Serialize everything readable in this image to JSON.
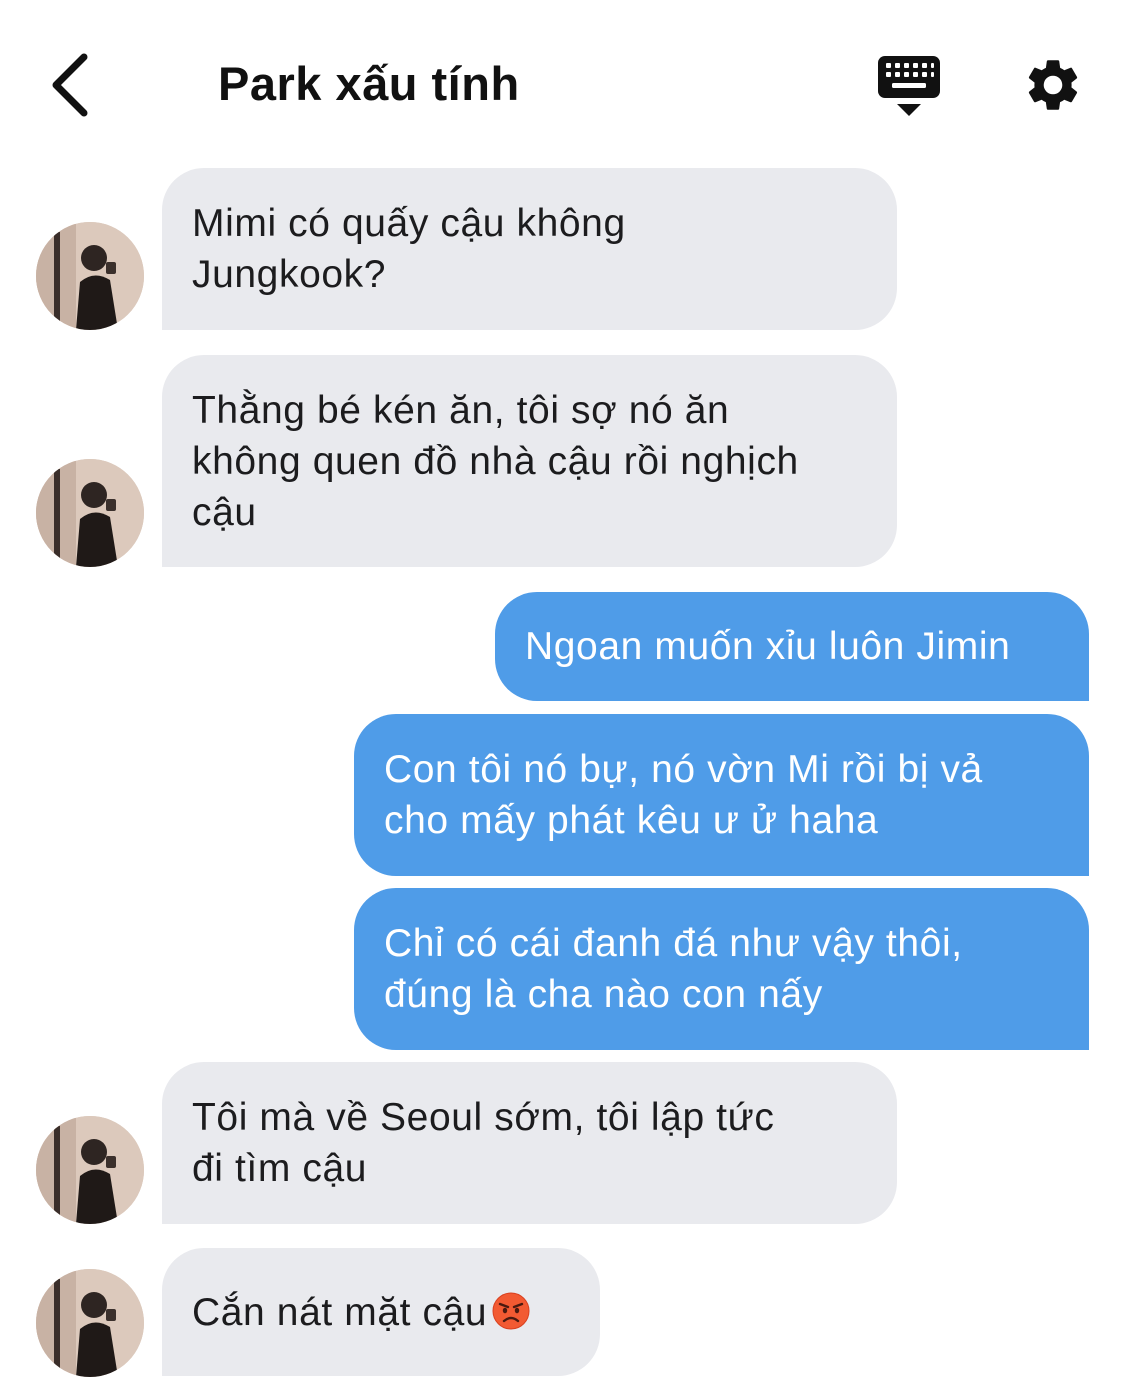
{
  "header": {
    "title": "Park xấu tính",
    "back_icon": "chevron-left-icon",
    "keyboard_icon": "keyboard-icon",
    "settings_icon": "gear-icon"
  },
  "colors": {
    "incoming_bubble": "#e9eaee",
    "outgoing_bubble": "#4f9ce8",
    "outgoing_text": "#ffffff",
    "incoming_text": "#1c1c1e"
  },
  "messages": [
    {
      "direction": "incoming",
      "lines": [
        "Mimi có quấy cậu không",
        "Jungkook?"
      ]
    },
    {
      "direction": "incoming",
      "lines": [
        "Thằng bé kén ăn, tôi sợ nó ăn",
        "không quen đồ nhà cậu rồi nghịch",
        "cậu"
      ]
    },
    {
      "direction": "outgoing",
      "lines": [
        "Ngoan muốn xỉu luôn Jimin"
      ]
    },
    {
      "direction": "outgoing",
      "lines": [
        "Con tôi nó bự, nó vờn Mi rồi bị vả",
        "cho mấy phát kêu ư ử haha"
      ]
    },
    {
      "direction": "outgoing",
      "lines": [
        "Chỉ có cái đanh đá như vậy thôi,",
        "đúng là cha nào con nấy"
      ]
    },
    {
      "direction": "incoming",
      "lines": [
        "Tôi mà về Seoul sớm, tôi lập tức",
        "đi tìm cậu"
      ]
    },
    {
      "direction": "incoming",
      "lines": [
        "Cắn nát mặt cậu"
      ],
      "emoji": "angry-face-emoji"
    }
  ]
}
